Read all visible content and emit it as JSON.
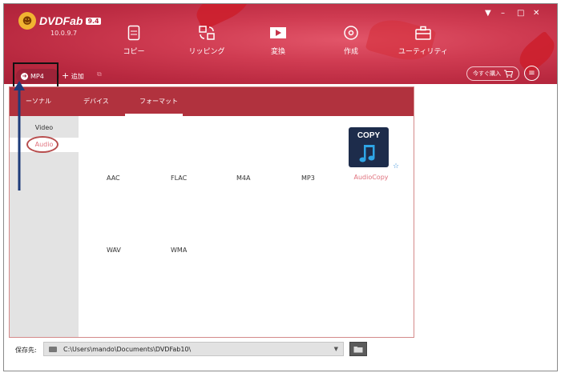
{
  "app": {
    "name": "DVDFab",
    "version_badge": "9.4",
    "version": "10.0.9.7",
    "window_controls": [
      "▼",
      "–",
      "□",
      "✕"
    ]
  },
  "nav": [
    {
      "label": "コピー",
      "icon": "copy-icon"
    },
    {
      "label": "リッピング",
      "icon": "ripper-icon"
    },
    {
      "label": "変換",
      "icon": "converter-icon"
    },
    {
      "label": "作成",
      "icon": "creator-icon"
    },
    {
      "label": "ユーティリティ",
      "icon": "toolbox-icon"
    }
  ],
  "toolbar": {
    "profile_label": "MP4",
    "add_label": "追加",
    "buy_label": "今すぐ購入"
  },
  "tabs": [
    "ーソナル",
    "デバイス",
    "フォーマット"
  ],
  "active_tab": "フォーマット",
  "sidebar": {
    "items": [
      "Video",
      "Audio"
    ],
    "selected": "Audio"
  },
  "formats": {
    "row1": [
      "AAC",
      "FLAC",
      "M4A",
      "MP3"
    ],
    "row2": [
      "WAV",
      "WMA"
    ],
    "featured": {
      "tile_text": "COPY",
      "label": "AudioCopy"
    }
  },
  "footer": {
    "save_label": "保存先:",
    "path": "C:\\Users\\mando\\Documents\\DVDFab10\\"
  },
  "colors": {
    "header": "#c63349",
    "tab_bar": "#b1323e",
    "accent_text": "#e0717d",
    "annotation_arrow": "#1d3b7a"
  }
}
